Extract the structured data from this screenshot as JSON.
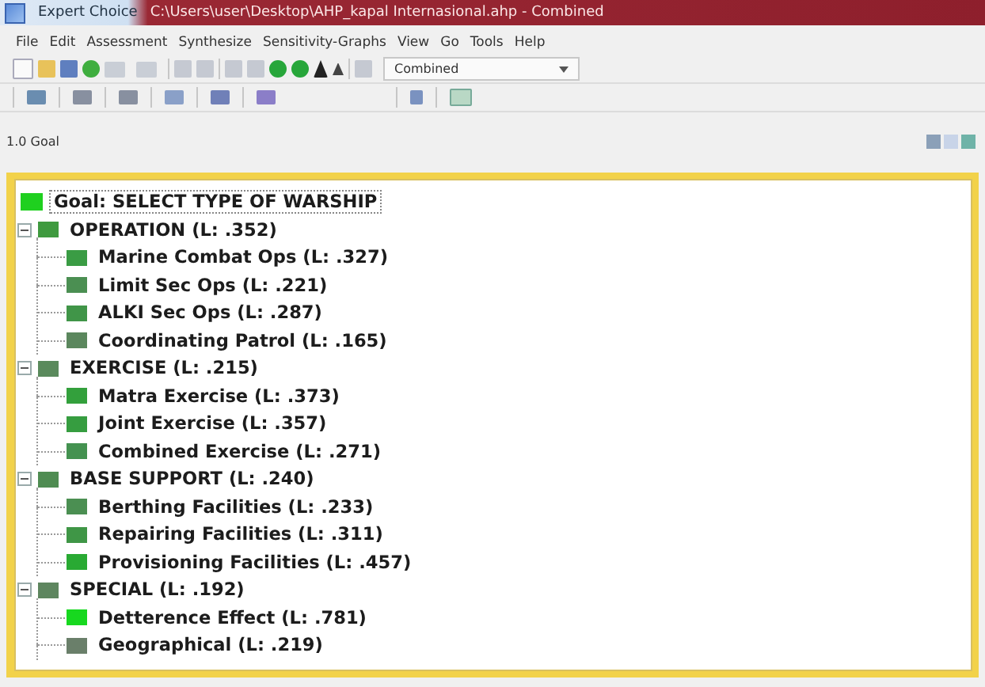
{
  "window": {
    "title": "Expert Choice",
    "path": "C:\\Users\\user\\Desktop\\AHP_kapal Internasional.ahp - Combined"
  },
  "menu": [
    "File",
    "Edit",
    "Assessment",
    "Synthesize",
    "Sensitivity-Graphs",
    "View",
    "Go",
    "Tools",
    "Help"
  ],
  "toolbar": {
    "mode_combo": "Combined"
  },
  "breadcrumb": "1.0 Goal",
  "tree": {
    "goal": {
      "label": "Goal: SELECT TYPE OF WARSHIP",
      "color": "#1fd01f",
      "selected": true
    },
    "nodes": [
      {
        "label": "OPERATION (L: .352)",
        "color": "#3f9a3f",
        "expanded": true,
        "children": [
          {
            "label": "Marine Combat Ops (L: .327)",
            "color": "#3a9c44"
          },
          {
            "label": "Limit Sec Ops (L: .221)",
            "color": "#4b8f52"
          },
          {
            "label": "ALKI Sec Ops (L: .287)",
            "color": "#409548"
          },
          {
            "label": "Coordinating Patrol (L: .165)",
            "color": "#5b875d"
          }
        ]
      },
      {
        "label": "EXERCISE (L: .215)",
        "color": "#5a8a5c",
        "expanded": true,
        "children": [
          {
            "label": "Matra Exercise (L: .373)",
            "color": "#33a03c"
          },
          {
            "label": "Joint Exercise (L: .357)",
            "color": "#369d40"
          },
          {
            "label": "Combined Exercise (L: .271)",
            "color": "#449250"
          }
        ]
      },
      {
        "label": "BASE SUPPORT (L: .240)",
        "color": "#4f8c52",
        "expanded": true,
        "children": [
          {
            "label": "Berthing Facilities (L: .233)",
            "color": "#4b8f52"
          },
          {
            "label": "Repairing Facilities (L: .311)",
            "color": "#3f9646"
          },
          {
            "label": "Provisioning Facilities (L: .457)",
            "color": "#29aa33"
          }
        ]
      },
      {
        "label": "SPECIAL (L: .192)",
        "color": "#5e865f",
        "expanded": true,
        "children": [
          {
            "label": "Detterence Effect (L: .781)",
            "color": "#17d81f"
          },
          {
            "label": "Geographical (L: .219)",
            "color": "#6a7f6a"
          }
        ]
      }
    ]
  }
}
